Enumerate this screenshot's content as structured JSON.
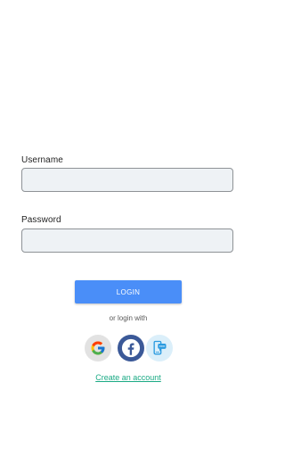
{
  "form": {
    "username_label": "Username",
    "username_value": "",
    "password_label": "Password",
    "password_value": ""
  },
  "login_button_label": "LOGIN",
  "alt_login_text": "or login with",
  "social_providers": [
    {
      "name": "Google",
      "icon": "google-icon"
    },
    {
      "name": "Facebook",
      "icon": "facebook-icon"
    },
    {
      "name": "SMS",
      "icon": "sms-phone-icon"
    }
  ],
  "create_account_link": "Create an account",
  "colors": {
    "primary_button": "#4a8ef8",
    "link": "#1aaa84",
    "facebook": "#3b5998",
    "input_background": "#eef2f5"
  }
}
